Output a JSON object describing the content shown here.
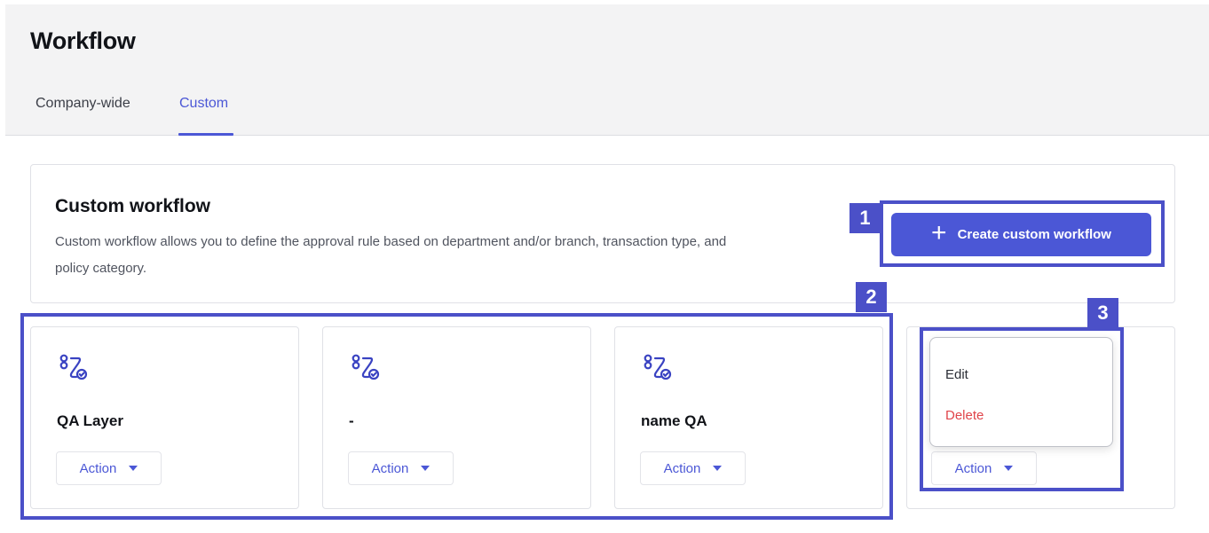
{
  "page": {
    "title": "Workflow"
  },
  "tabs": [
    {
      "label": "Company-wide",
      "active": false
    },
    {
      "label": "Custom",
      "active": true
    }
  ],
  "intro": {
    "title": "Custom workflow",
    "description": "Custom workflow allows you to define the approval rule based on department and/or branch, transaction type, and policy category."
  },
  "create_button": {
    "label": "Create custom workflow",
    "icon": "plus-icon"
  },
  "workflows": [
    {
      "name": "QA Layer",
      "action_label": "Action"
    },
    {
      "name": "-",
      "action_label": "Action"
    },
    {
      "name": "name QA",
      "action_label": "Action"
    },
    {
      "name": "",
      "action_label": "Action"
    }
  ],
  "dropdown": {
    "items": [
      {
        "label": "Edit"
      },
      {
        "label": "Delete"
      }
    ]
  },
  "annotations": [
    {
      "label": "1"
    },
    {
      "label": "2"
    },
    {
      "label": "3"
    }
  ],
  "colors": {
    "accent": "#4b57d6",
    "highlight": "#4b50c8",
    "danger": "#e0444a"
  }
}
